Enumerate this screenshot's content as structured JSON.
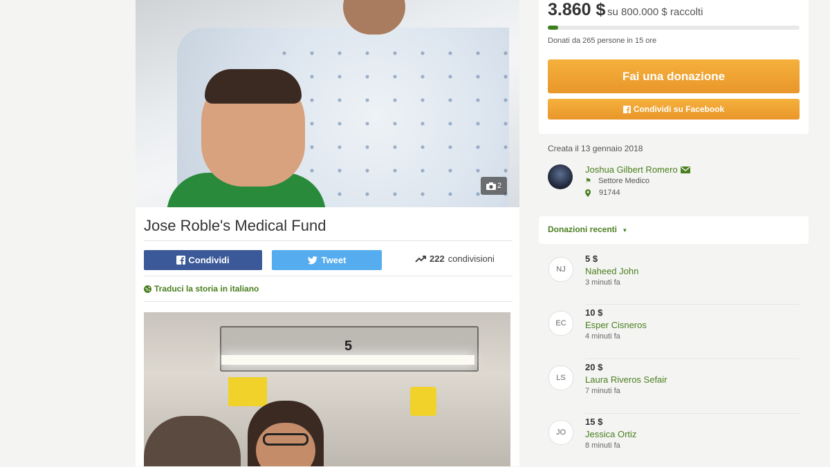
{
  "campaign": {
    "title": "Jose Roble's Medical Fund",
    "photo_count": "2",
    "share_facebook_label": "Condividi",
    "tweet_label": "Tweet",
    "shares_count": "222",
    "shares_label": "condivisioni",
    "translate_label": "Traduci la storia in italiano",
    "photo_room_number": "5"
  },
  "donation_box": {
    "raised": "3.860 $",
    "goal_text": "su 800.000 $ raccolti",
    "progress_fraction": 0.005,
    "donors_text": "Donati da 265 persone in 15 ore",
    "donate_label": "Fai una donazione",
    "share_fb_label": "Condividi su Facebook"
  },
  "organizer": {
    "created": "Creata il 13 gennaio 2018",
    "name": "Joshua Gilbert Romero",
    "category": "Settore Medico",
    "zip": "91744"
  },
  "recent": {
    "label": "Donazioni recenti",
    "donations": [
      {
        "initials": "NJ",
        "amount": "5 $",
        "name": "Naheed John",
        "time": "3 minuti fa"
      },
      {
        "initials": "EC",
        "amount": "10 $",
        "name": "Esper Cisneros",
        "time": "4 minuti fa"
      },
      {
        "initials": "LS",
        "amount": "20 $",
        "name": "Laura Riveros Sefair",
        "time": "7 minuti fa"
      },
      {
        "initials": "JO",
        "amount": "15 $",
        "name": "Jessica Ortiz",
        "time": "8 minuti fa"
      }
    ]
  },
  "colors": {
    "facebook": "#3b5998",
    "twitter": "#55acee",
    "donate": "#f0a532",
    "green": "#4a7f1f"
  }
}
